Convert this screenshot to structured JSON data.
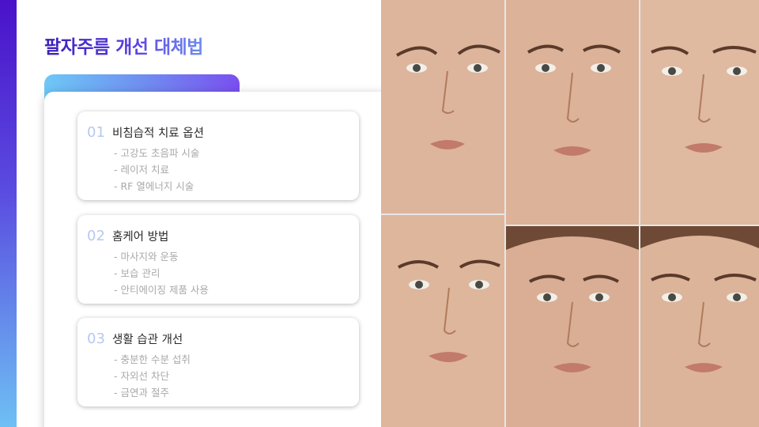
{
  "slide": {
    "title": "팔자주름 개선 대체법",
    "colors": {
      "accent_gradient": [
        "#4a12c9",
        "#6ec0f4"
      ],
      "tab_gradient": [
        "#6ec8f6",
        "#7a4ff0"
      ],
      "number_color": "#b7c8f0"
    }
  },
  "cards": [
    {
      "number": "01",
      "title": "비침습적 치료 옵션",
      "items": [
        "- 고강도 초음파 시술",
        "- 레이저 치료",
        "- RF 열에너지 시술"
      ]
    },
    {
      "number": "02",
      "title": "홈케어 방법",
      "items": [
        "- 마사지와 운동",
        "- 보습 관리",
        "- 안티에이징 제품 사용"
      ]
    },
    {
      "number": "03",
      "title": "생활 습관 개선",
      "items": [
        "- 충분한 수분 섭취",
        "- 자외선 차단",
        "- 금연과 절주"
      ]
    }
  ],
  "photos": [
    "face-photo",
    "face-photo",
    "face-photo",
    "face-photo",
    "face-photo",
    "face-photo"
  ]
}
